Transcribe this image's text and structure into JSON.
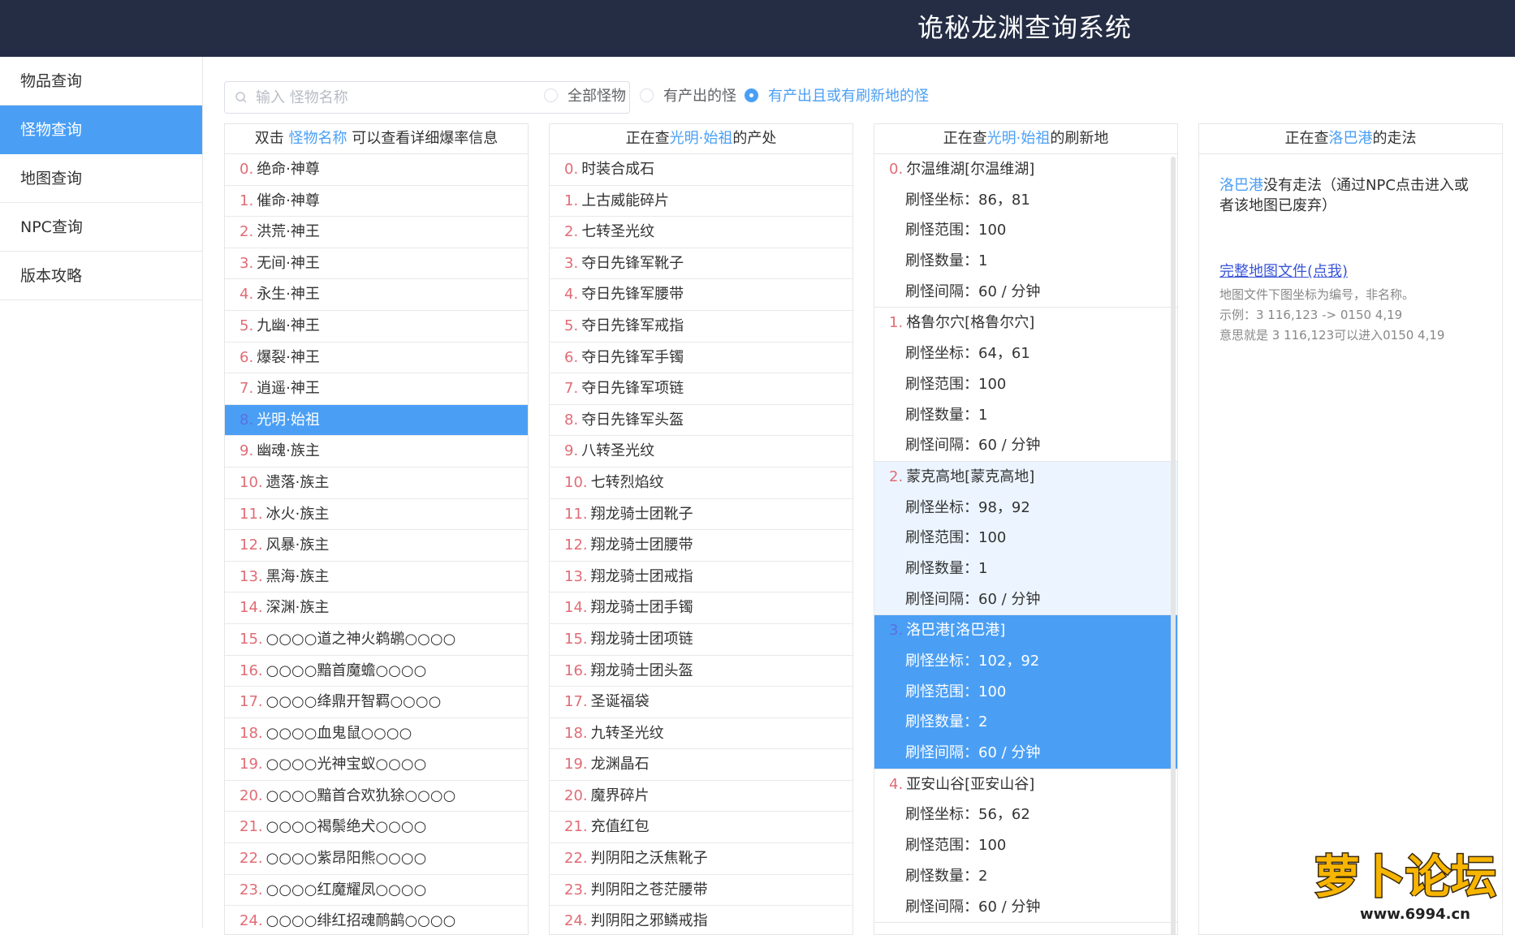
{
  "header": {
    "title": "诡秘龙渊查询系统"
  },
  "sidebar": {
    "items": [
      {
        "label": "物品查询"
      },
      {
        "label": "怪物查询",
        "active": true
      },
      {
        "label": "地图查询"
      },
      {
        "label": "NPC查询"
      },
      {
        "label": "版本攻略"
      }
    ]
  },
  "search": {
    "placeholder": "输入 怪物名称"
  },
  "filters": [
    {
      "label": "全部怪物",
      "checked": false
    },
    {
      "label": "有产出的怪",
      "checked": false
    },
    {
      "label": "有产出且或有刷新地的怪",
      "checked": true
    }
  ],
  "monsters": {
    "head_pre": "双击 ",
    "head_hl": "怪物名称",
    "head_post": " 可以查看详细爆率信息",
    "selected": 8,
    "items": [
      "绝命·神尊",
      "催命·神尊",
      "洪荒·神王",
      "无间·神王",
      "永生·神王",
      "九幽·神王",
      "爆裂·神王",
      "逍遥·神王",
      "光明·始祖",
      "幽魂·族主",
      "遗落·族主",
      "冰火·族主",
      "风暴·族主",
      "黑海·族主",
      "深渊·族主",
      "○○○○道之神火鹈鹕○○○○",
      "○○○○黯首魔蟾○○○○",
      "○○○○绛鼎开智羁○○○○",
      "○○○○血鬼鼠○○○○",
      "○○○○光神宝蚁○○○○",
      "○○○○黯首合欢犰狳○○○○",
      "○○○○褐鬃绝犬○○○○",
      "○○○○紫昂阳熊○○○○",
      "○○○○红魔耀凤○○○○",
      "○○○○绯红招魂鸸鹋○○○○"
    ]
  },
  "drops": {
    "head_pre": "正在查",
    "head_hl": "光明·始祖",
    "head_post": "的产处",
    "items": [
      "时装合成石",
      "上古威能碎片",
      "七转圣光纹",
      "夺日先锋军靴子",
      "夺日先锋军腰带",
      "夺日先锋军戒指",
      "夺日先锋军手镯",
      "夺日先锋军项链",
      "夺日先锋军头盔",
      "八转圣光纹",
      "七转烈焰纹",
      "翔龙骑士团靴子",
      "翔龙骑士团腰带",
      "翔龙骑士团戒指",
      "翔龙骑士团手镯",
      "翔龙骑士团项链",
      "翔龙骑士团头盔",
      "圣诞福袋",
      "九转圣光纹",
      "龙渊晶石",
      "魔界碎片",
      "充值红包",
      "判阴阳之沃焦靴子",
      "判阴阳之苍茫腰带",
      "判阴阳之邪鳞戒指"
    ]
  },
  "maps": {
    "head_pre": "正在查",
    "head_hl": "光明·始祖",
    "head_post": "的刷新地",
    "labels": {
      "coord": "刷怪坐标：",
      "range": "刷怪范围：",
      "count": "刷怪数量：",
      "interval": "刷怪间隔："
    },
    "groups": [
      {
        "name": "尔温维湖[尔温维湖]",
        "coord": "86，81",
        "range": "100",
        "count": "1",
        "interval": "60 / 分钟",
        "state": ""
      },
      {
        "name": "格鲁尔穴[格鲁尔穴]",
        "coord": "64，61",
        "range": "100",
        "count": "1",
        "interval": "60 / 分钟",
        "state": ""
      },
      {
        "name": "蒙克高地[蒙克高地]",
        "coord": "98，92",
        "range": "100",
        "count": "1",
        "interval": "60 / 分钟",
        "state": "hover"
      },
      {
        "name": "洛巴港[洛巴港]",
        "coord": "102，92",
        "range": "100",
        "count": "2",
        "interval": "60 / 分钟",
        "state": "sel"
      },
      {
        "name": "亚安山谷[亚安山谷]",
        "coord": "56，62",
        "range": "100",
        "count": "2",
        "interval": "60 / 分钟",
        "state": ""
      }
    ]
  },
  "route": {
    "head_pre": "正在查",
    "head_hl": "洛巴港",
    "head_post": "的走法",
    "text_hl": "洛巴港",
    "text": "没有走法（通过NPC点击进入或者该地图已废弃）",
    "link": "完整地图文件(点我)",
    "notes": [
      "地图文件下图坐标为编号，非名称。",
      "示例：3 116,123 -> 0150 4,19",
      "意思就是 3 116,123可以进入0150 4,19"
    ]
  },
  "watermark": {
    "text": "萝卜论坛",
    "url": "www.6994.cn"
  }
}
